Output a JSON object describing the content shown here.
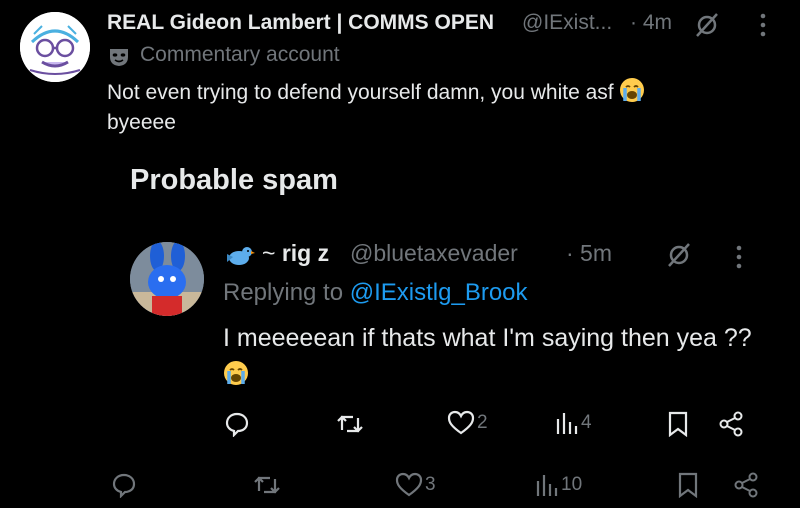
{
  "tweet": {
    "display_name": "REAL Gideon Lambert | COMMS OPEN",
    "handle": "@IExist...",
    "time": "· 4m",
    "label": "Commentary account",
    "text": "Not even trying to defend yourself damn, you white asf",
    "text_line2": "byeeee"
  },
  "spam_section": {
    "title": "Probable spam"
  },
  "reply": {
    "prefix": "~ ",
    "display_name": "rig z",
    "handle": "@bluetaxevader",
    "time": "· 5m",
    "replying_prefix": "Replying to ",
    "replying_to": "@IExistlg_Brook",
    "text": "I meeeeean if thats what I'm saying then yea ??",
    "actions": {
      "likes": "2",
      "views": "4"
    }
  },
  "tweet_actions": {
    "likes": "3",
    "views": "10"
  },
  "colors": {
    "background": "#000000",
    "text": "#e7e9ea",
    "muted": "#71767b",
    "link": "#1d9bf0"
  },
  "icons": [
    "grok-icon",
    "more-icon",
    "mask-icon",
    "bird-icon",
    "crying-emoji",
    "reply-icon",
    "retweet-icon",
    "heart-icon",
    "views-icon",
    "bookmark-icon",
    "share-icon"
  ]
}
